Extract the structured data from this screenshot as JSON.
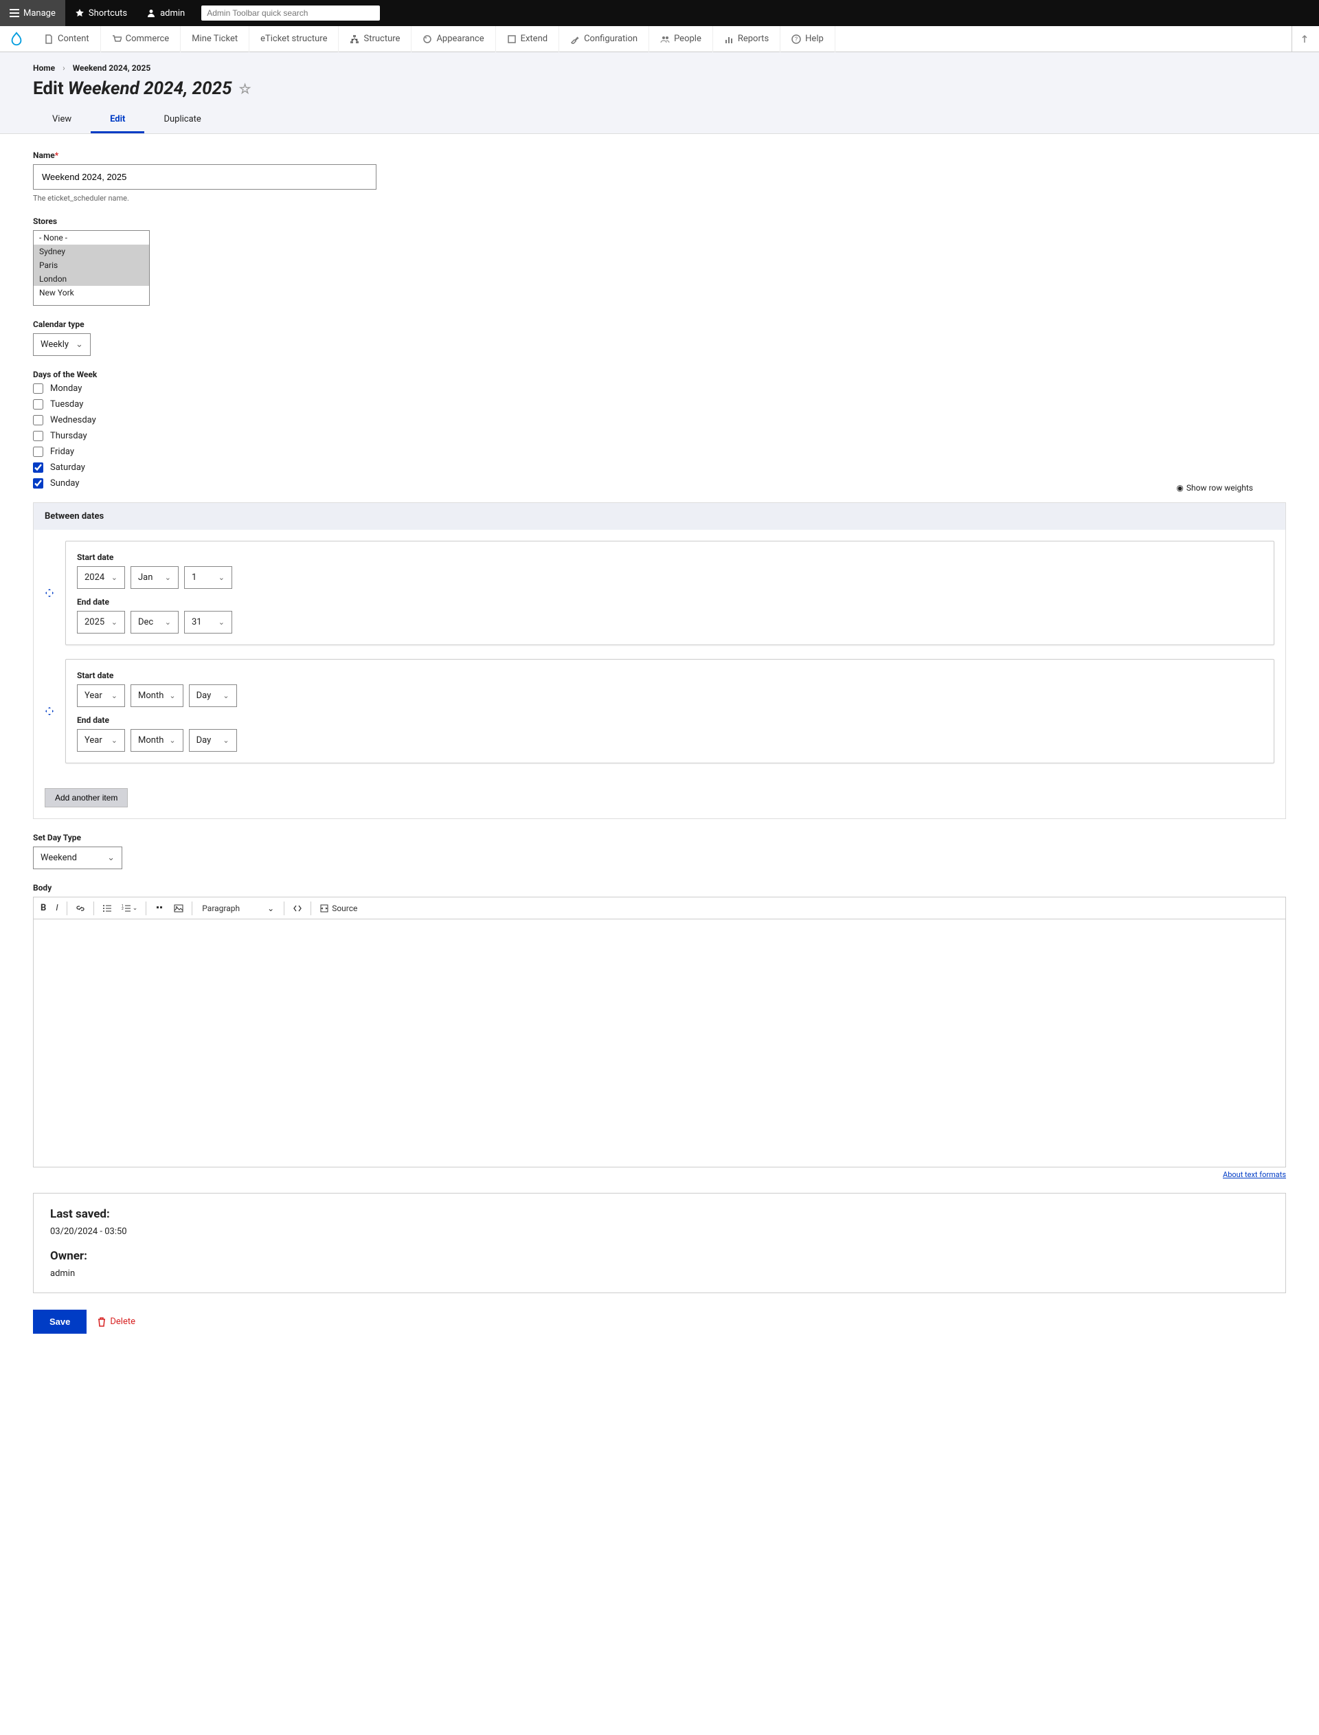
{
  "topbar": {
    "manage": "Manage",
    "shortcuts": "Shortcuts",
    "admin": "admin",
    "search_placeholder": "Admin Toolbar quick search"
  },
  "adminmenu": {
    "items": [
      "Content",
      "Commerce",
      "Mine Ticket",
      "eTicket structure",
      "Structure",
      "Appearance",
      "Extend",
      "Configuration",
      "People",
      "Reports",
      "Help"
    ]
  },
  "breadcrumb": {
    "home": "Home",
    "current": "Weekend 2024, 2025"
  },
  "page_title": {
    "prefix": "Edit",
    "name": "Weekend 2024, 2025"
  },
  "tabs": {
    "view": "View",
    "edit": "Edit",
    "duplicate": "Duplicate"
  },
  "form": {
    "name": {
      "label": "Name",
      "value": "Weekend 2024, 2025",
      "desc": "The eticket_scheduler name."
    },
    "stores": {
      "label": "Stores",
      "options": [
        "- None -",
        "Sydney",
        "Paris",
        "London",
        "New York"
      ],
      "selected": [
        "Sydney",
        "Paris",
        "London"
      ]
    },
    "calendar_type": {
      "label": "Calendar type",
      "value": "Weekly"
    },
    "days": {
      "label": "Days of the Week",
      "options": [
        {
          "label": "Monday",
          "checked": false
        },
        {
          "label": "Tuesday",
          "checked": false
        },
        {
          "label": "Wednesday",
          "checked": false
        },
        {
          "label": "Thursday",
          "checked": false
        },
        {
          "label": "Friday",
          "checked": false
        },
        {
          "label": "Saturday",
          "checked": true
        },
        {
          "label": "Sunday",
          "checked": true
        }
      ]
    },
    "between_dates": {
      "legend": "Between dates",
      "show_weights": "Show row weights",
      "start_label": "Start date",
      "end_label": "End date",
      "rows": [
        {
          "start": {
            "year": "2024",
            "month": "Jan",
            "day": "1"
          },
          "end": {
            "year": "2025",
            "month": "Dec",
            "day": "31"
          }
        },
        {
          "start": {
            "year": "Year",
            "month": "Month",
            "day": "Day"
          },
          "end": {
            "year": "Year",
            "month": "Month",
            "day": "Day"
          }
        }
      ],
      "add": "Add another item"
    },
    "day_type": {
      "label": "Set Day Type",
      "value": "Weekend"
    },
    "body": {
      "label": "Body",
      "paragraph": "Paragraph",
      "source": "Source",
      "about": "About text formats"
    },
    "meta": {
      "last_saved_label": "Last saved:",
      "last_saved_value": "03/20/2024 - 03:50",
      "owner_label": "Owner:",
      "owner_value": "admin"
    },
    "actions": {
      "save": "Save",
      "delete": "Delete"
    }
  }
}
